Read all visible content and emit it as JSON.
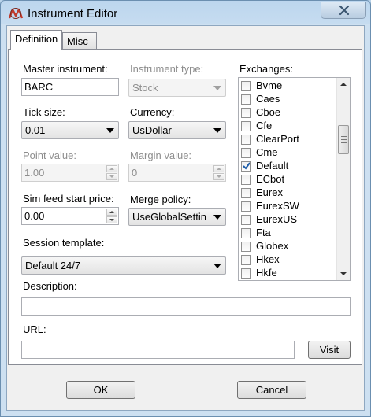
{
  "window": {
    "title": "Instrument Editor"
  },
  "tabs": [
    {
      "label": "Definition",
      "active": true
    },
    {
      "label": "Misc",
      "active": false
    }
  ],
  "fields": {
    "master_instrument": {
      "label": "Master instrument:",
      "value": "BARC"
    },
    "instrument_type": {
      "label": "Instrument type:",
      "value": "Stock",
      "disabled": true
    },
    "tick_size": {
      "label": "Tick size:",
      "value": "0.01"
    },
    "currency": {
      "label": "Currency:",
      "value": "UsDollar"
    },
    "point_value": {
      "label": "Point value:",
      "value": "1.00",
      "disabled": true
    },
    "margin_value": {
      "label": "Margin value:",
      "value": "0",
      "disabled": true
    },
    "sim_feed_start_price": {
      "label": "Sim feed start price:",
      "value": "0.00"
    },
    "merge_policy": {
      "label": "Merge policy:",
      "value": "UseGlobalSettin"
    },
    "session_template": {
      "label": "Session template:",
      "value": "Default 24/7"
    },
    "description": {
      "label": "Description:",
      "value": ""
    },
    "url": {
      "label": "URL:",
      "value": ""
    }
  },
  "exchanges": {
    "label": "Exchanges:",
    "items": [
      {
        "name": "Bvme",
        "checked": false
      },
      {
        "name": "Caes",
        "checked": false
      },
      {
        "name": "Cboe",
        "checked": false
      },
      {
        "name": "Cfe",
        "checked": false
      },
      {
        "name": "ClearPort",
        "checked": false
      },
      {
        "name": "Cme",
        "checked": false
      },
      {
        "name": "Default",
        "checked": true
      },
      {
        "name": "ECbot",
        "checked": false
      },
      {
        "name": "Eurex",
        "checked": false
      },
      {
        "name": "EurexSW",
        "checked": false
      },
      {
        "name": "EurexUS",
        "checked": false
      },
      {
        "name": "Fta",
        "checked": false
      },
      {
        "name": "Globex",
        "checked": false
      },
      {
        "name": "Hkex",
        "checked": false
      },
      {
        "name": "Hkfe",
        "checked": false
      }
    ]
  },
  "buttons": {
    "visit": "Visit",
    "ok": "OK",
    "cancel": "Cancel"
  },
  "colors": {
    "accent": "#1d5ca8",
    "logo_red": "#c0392b",
    "close_x": "#3a5570"
  }
}
